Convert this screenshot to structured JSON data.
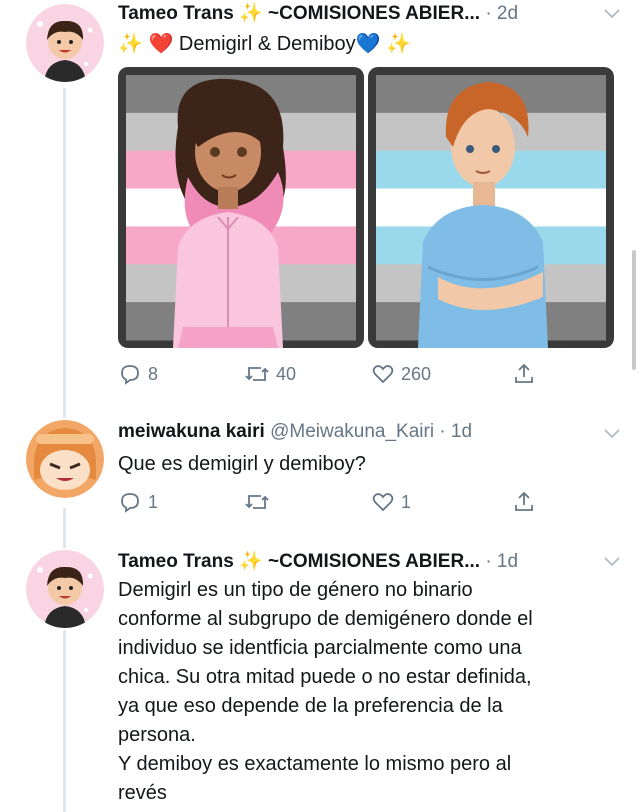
{
  "tweets": [
    {
      "author": "Tameo Trans ✨ ~COMISIONES ABIER...",
      "time": "· 2d",
      "text_line": "✨ ❤️ Demigirl & Demiboy💙 ✨",
      "actions": {
        "reply": "8",
        "retweet": "40",
        "like": "260"
      }
    },
    {
      "author": "meiwakuna kairi",
      "handle": "@Meiwakuna_Kairi",
      "time": "· 1d",
      "text": "Que es demigirl y demiboy?",
      "actions": {
        "reply": "1",
        "retweet": "",
        "like": "1"
      }
    },
    {
      "author": "Tameo Trans ✨ ~COMISIONES ABIER...",
      "time": "· 1d",
      "lines": [
        "Demigirl es un tipo de género no binario",
        "conforme al subgrupo de demigénero donde el",
        "individuo se identficia parcialmente como una",
        "chica. Su otra mitad puede o no estar definida,",
        "ya que eso depende de la preferencia de la",
        "persona.",
        "Y demiboy es exactamente lo mismo pero al",
        "revés"
      ]
    }
  ],
  "flags": {
    "demigirl": [
      "#808080",
      "#c4c4c4",
      "#f6a8c6",
      "#ffffff",
      "#f6a8c6",
      "#c4c4c4",
      "#808080"
    ],
    "demiboy": [
      "#808080",
      "#c4c4c4",
      "#9ad9eb",
      "#ffffff",
      "#9ad9eb",
      "#c4c4c4",
      "#808080"
    ]
  },
  "colors": {
    "muted": "#657786",
    "line": "#e1e8ed",
    "heart": "#e0245e",
    "blue_heart": "#1d9bf0"
  },
  "icons": [
    "reply-icon",
    "retweet-icon",
    "like-icon",
    "share-icon",
    "chevron-down-icon",
    "sparkle-icon"
  ]
}
